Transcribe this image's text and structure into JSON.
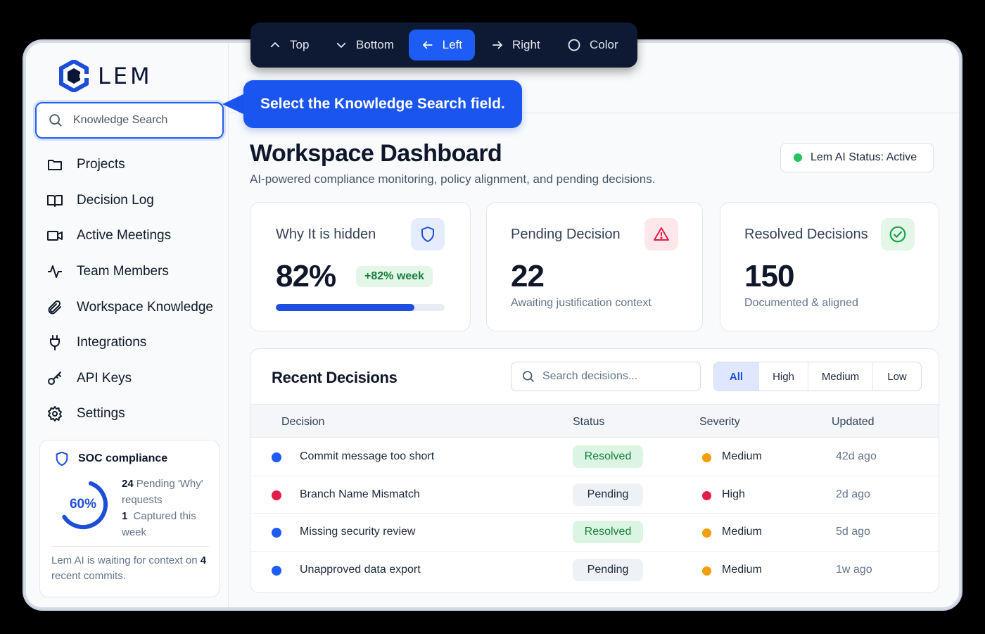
{
  "brand": {
    "name": "LEM"
  },
  "sidebar": {
    "search_placeholder": "Knowledge Search",
    "items": [
      {
        "label": "Projects",
        "icon": "folder-icon"
      },
      {
        "label": "Decision Log",
        "icon": "book-icon"
      },
      {
        "label": "Active Meetings",
        "icon": "video-icon"
      },
      {
        "label": "Team Members",
        "icon": "activity-icon"
      },
      {
        "label": "Workspace Knowledge",
        "icon": "paperclip-icon"
      },
      {
        "label": "Integrations",
        "icon": "plug-icon"
      },
      {
        "label": "API Keys",
        "icon": "key-icon"
      },
      {
        "label": "Settings",
        "icon": "gear-icon"
      }
    ],
    "soc": {
      "title": "SOC compliance",
      "percent_label": "60%",
      "percent": 0.6,
      "stat1_num": "24",
      "stat1_text": "Pending 'Why' requests",
      "stat2_num": "1",
      "stat2_text": "Captured this week",
      "foot_pre": "Lem AI is waiting for context on",
      "foot_num": "4",
      "foot_post": "recent commits."
    }
  },
  "toolbar": {
    "buttons": [
      {
        "label": "Top",
        "icon": "chevron-up-icon",
        "active": false
      },
      {
        "label": "Bottom",
        "icon": "chevron-down-icon",
        "active": false
      },
      {
        "label": "Left",
        "icon": "arrow-left-icon",
        "active": true
      },
      {
        "label": "Right",
        "icon": "arrow-right-icon",
        "active": false
      },
      {
        "label": "Color",
        "icon": "circle-icon",
        "active": false
      }
    ]
  },
  "callout": {
    "text": "Select the Knowledge Search field."
  },
  "header": {
    "title": "Workspace Dashboard",
    "subtitle": "AI-powered compliance monitoring, policy alignment, and pending decisions.",
    "status": "Lem AI Status: Active"
  },
  "cards": [
    {
      "title": "Why It is hidden",
      "value": "82%",
      "badge": "+82% week",
      "progress": 0.82,
      "icon": "shield-icon"
    },
    {
      "title": "Pending Decision",
      "value": "22",
      "sub": "Awaiting justification context",
      "icon": "alert-triangle-icon"
    },
    {
      "title": "Resolved Decisions",
      "value": "150",
      "sub": "Documented & aligned",
      "icon": "check-circle-icon"
    }
  ],
  "recent": {
    "title": "Recent Decisions",
    "search_placeholder": "Search decisions...",
    "filters": [
      "All",
      "High",
      "Medium",
      "Low"
    ],
    "active_filter": "All",
    "columns": [
      "Decision",
      "Status",
      "Severity",
      "Updated"
    ],
    "rows": [
      {
        "decision": "Commit message too short",
        "status": "Resolved",
        "severity": "Medium",
        "updated": "42d ago",
        "dot": "#1d5cf5"
      },
      {
        "decision": "Branch Name Mismatch",
        "status": "Pending",
        "severity": "High",
        "updated": "2d ago",
        "dot": "#e11d48"
      },
      {
        "decision": "Missing security review",
        "status": "Resolved",
        "severity": "Medium",
        "updated": "5d ago",
        "dot": "#1d5cf5"
      },
      {
        "decision": "Unapproved data export",
        "status": "Pending",
        "severity": "Medium",
        "updated": "1w ago",
        "dot": "#1d5cf5"
      }
    ]
  },
  "colors": {
    "accent": "#1d5cf5",
    "success": "#22c55e",
    "danger": "#e11d48",
    "warning": "#f59e0b"
  }
}
